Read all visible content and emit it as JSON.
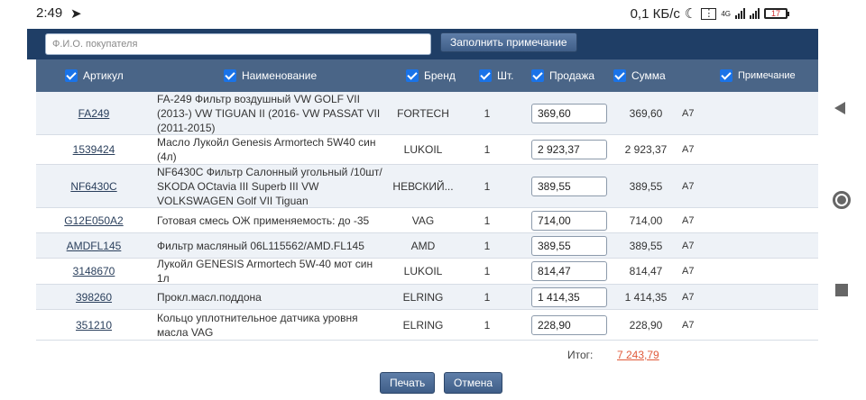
{
  "status": {
    "time": "2:49",
    "speed": "0,1 КБ/с",
    "network": "4G",
    "battery": "17"
  },
  "toolbar": {
    "buyer_placeholder": "Ф.И.О. покупателя",
    "fill_note_label": "Заполнить примечание"
  },
  "columns": {
    "article": "Артикул",
    "name": "Наименование",
    "brand": "Бренд",
    "qty": "Шт.",
    "sale": "Продажа",
    "sum": "Сумма",
    "note": "Примечание"
  },
  "rows": [
    {
      "article": "FA249",
      "name": "FA-249 Фильтр воздушный VW GOLF VII (2013-) VW TIGUAN II (2016- VW PASSAT VII (2011-2015)",
      "brand": "FORTECH",
      "qty": "1",
      "sale": "369,60",
      "sum": "369,60",
      "note": "А7"
    },
    {
      "article": "1539424",
      "name": "Масло Лукойл Genesis Armortech 5W40 син (4л)",
      "brand": "LUKOIL",
      "qty": "1",
      "sale": "2 923,37",
      "sum": "2 923,37",
      "note": "А7"
    },
    {
      "article": "NF6430C",
      "name": "NF6430C Фильтр Салонный угольный /10шт/ SKODA OCtavia III Superb III VW VOLKSWAGEN Golf VII Tiguan",
      "brand": "НЕВСКИЙ...",
      "qty": "1",
      "sale": "389,55",
      "sum": "389,55",
      "note": "А7"
    },
    {
      "article": "G12E050A2",
      "name": "Готовая смесь ОЖ применяемость: до -35",
      "brand": "VAG",
      "qty": "1",
      "sale": "714,00",
      "sum": "714,00",
      "note": "А7"
    },
    {
      "article": "AMDFL145",
      "name": "Фильтр масляный 06L115562/AMD.FL145",
      "brand": "AMD",
      "qty": "1",
      "sale": "389,55",
      "sum": "389,55",
      "note": "А7"
    },
    {
      "article": "3148670",
      "name": "Лукойл GENESIS Armortech 5W-40 мот син 1л",
      "brand": "LUKOIL",
      "qty": "1",
      "sale": "814,47",
      "sum": "814,47",
      "note": "А7"
    },
    {
      "article": "398260",
      "name": "Прокл.масл.поддона",
      "brand": "ELRING",
      "qty": "1",
      "sale": "1 414,35",
      "sum": "1 414,35",
      "note": "А7"
    },
    {
      "article": "351210",
      "name": "Кольцо уплотнительное датчика уровня масла VAG",
      "brand": "ELRING",
      "qty": "1",
      "sale": "228,90",
      "sum": "228,90",
      "note": "А7"
    }
  ],
  "total": {
    "label": "Итог:",
    "value": "7 243,79"
  },
  "footer": {
    "print_label": "Печать",
    "cancel_label": "Отмена"
  },
  "colors": {
    "header_bg": "#4a6587",
    "toolbar_bg": "#1f3e66",
    "checkbox": "#1a73e8",
    "total_value": "#e05a3a"
  }
}
